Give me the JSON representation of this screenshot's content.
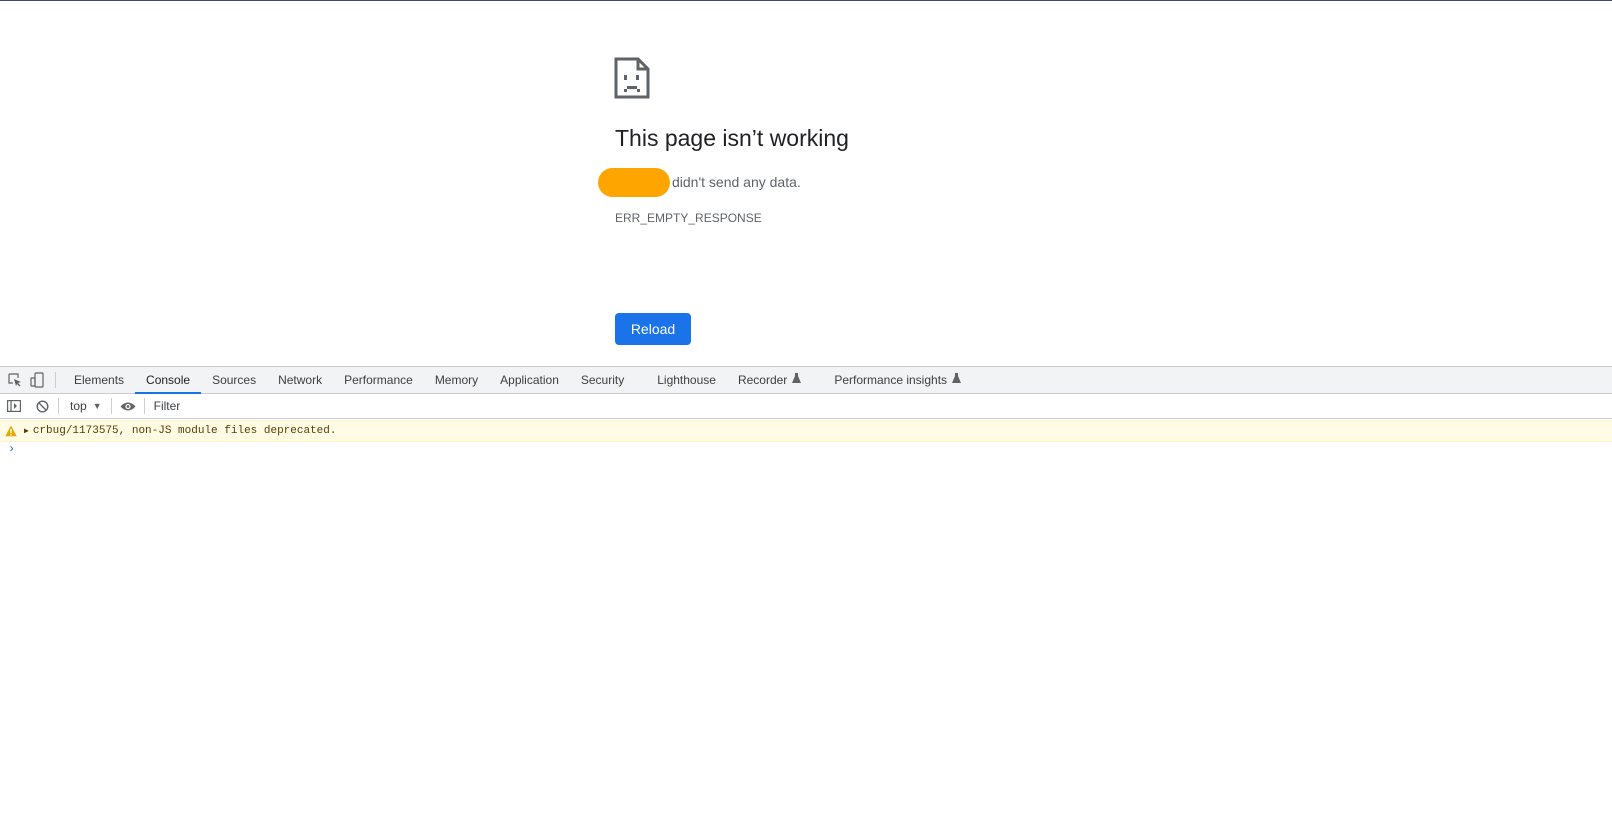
{
  "error_page": {
    "title": "This page isn’t working",
    "description": "didn't send any data.",
    "error_code": "ERR_EMPTY_RESPONSE",
    "reload_label": "Reload",
    "icon": "sad-page-icon"
  },
  "devtools": {
    "tabs": [
      {
        "label": "Elements"
      },
      {
        "label": "Console",
        "active": true
      },
      {
        "label": "Sources"
      },
      {
        "label": "Network"
      },
      {
        "label": "Performance"
      },
      {
        "label": "Memory"
      },
      {
        "label": "Application"
      },
      {
        "label": "Security"
      },
      {
        "label": "Lighthouse"
      },
      {
        "label": "Recorder",
        "experimental": true
      },
      {
        "label": "Performance insights",
        "experimental": true
      }
    ],
    "toolbar": {
      "context": "top",
      "filter_placeholder": "Filter"
    },
    "console": {
      "warning": "crbug/1173575, non-JS module files deprecated.",
      "prompt": "›"
    }
  },
  "colors": {
    "accent": "#1a73e8",
    "redaction": "#ffa500",
    "warning_bg": "#fffbe5",
    "warning_text": "#5c3c00"
  }
}
